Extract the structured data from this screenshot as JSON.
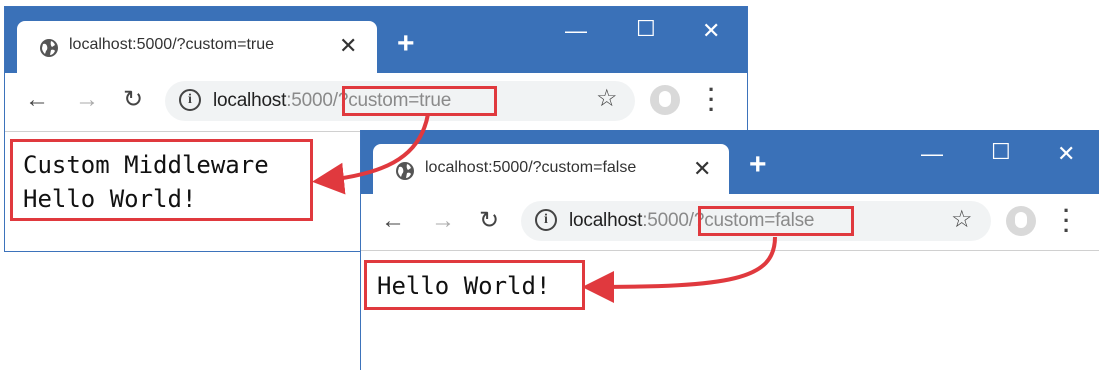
{
  "window1": {
    "tab_title": "localhost:5000/?custom=true",
    "url_host": "localhost",
    "url_port": ":5000",
    "url_path": "/?custom=true",
    "output_lines": [
      "Custom Middleware",
      "Hello World!"
    ]
  },
  "window2": {
    "tab_title": "localhost:5000/?custom=false",
    "url_host": "localhost",
    "url_port": ":5000",
    "url_path": "/?custom=false",
    "output_lines": [
      "Hello World!"
    ]
  },
  "icons": {
    "tab_favicon": "globe-icon",
    "tab_close": "close-icon",
    "new_tab": "plus-icon",
    "minimize": "minimize-icon",
    "maximize": "maximize-icon",
    "close_window": "close-icon",
    "back": "back-arrow-icon",
    "forward": "forward-arrow-icon",
    "reload": "reload-icon",
    "site_info": "info-icon",
    "bookmark": "star-icon",
    "profile": "avatar-icon",
    "menu": "kebab-menu-icon"
  },
  "colors": {
    "titlebar": "#3a71b8",
    "highlight": "#e0393e",
    "omnibox_bg": "#f1f3f4"
  }
}
